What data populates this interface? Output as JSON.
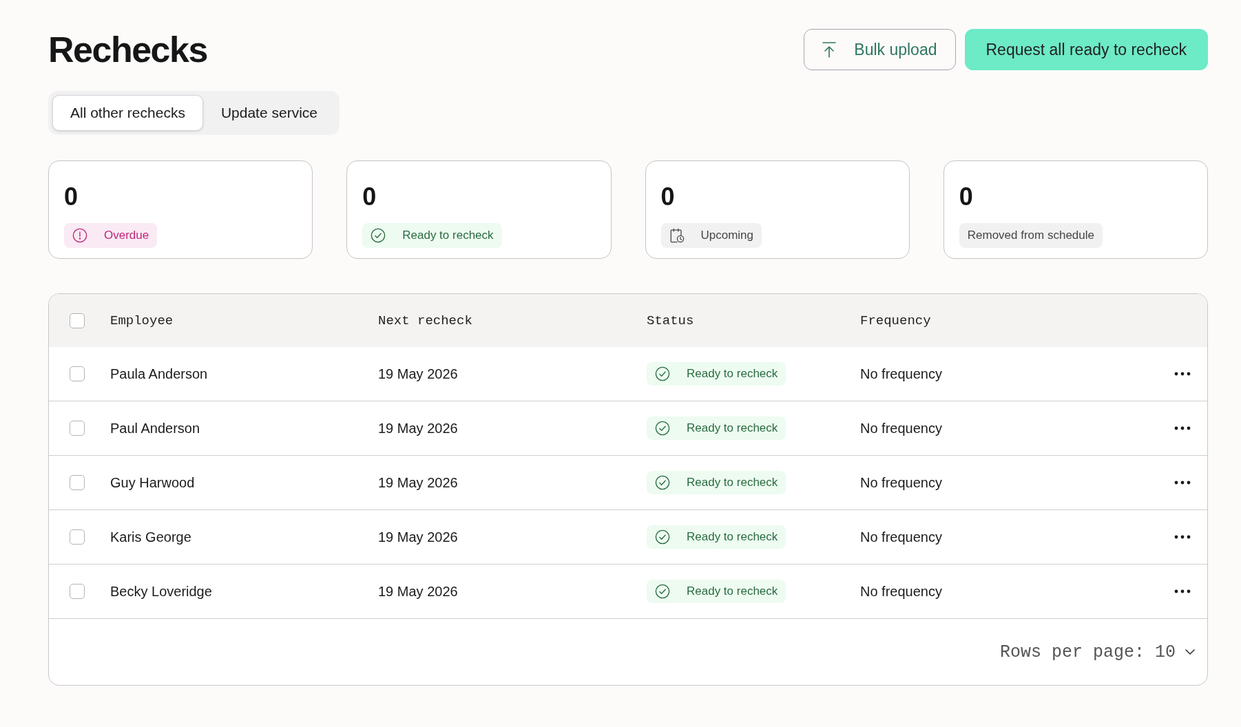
{
  "page": {
    "title": "Rechecks"
  },
  "actions": [
    {
      "kind": "secondary",
      "label": "Bulk upload"
    },
    {
      "kind": "primary",
      "label": "Request all ready to recheck"
    }
  ],
  "tabs": [
    {
      "label": "All other rechecks",
      "selected": true
    },
    {
      "label": "Update service",
      "selected": false
    }
  ],
  "summary_cards": [
    {
      "count": "0",
      "status": {
        "kind": "overdue",
        "label": "Overdue"
      }
    },
    {
      "count": "0",
      "status": {
        "kind": "ready",
        "label": "Ready to recheck"
      }
    },
    {
      "count": "0",
      "status": {
        "kind": "upcoming",
        "label": "Upcoming"
      }
    },
    {
      "count": "0",
      "status": {
        "kind": "removed",
        "label": "Removed from schedule"
      }
    }
  ],
  "table": {
    "header_checkbox": {
      "checked": false
    },
    "columns": [
      "Employee",
      "Next recheck",
      "Status",
      "Frequency"
    ],
    "rows": [
      {
        "checked": false,
        "employee": "Paula Anderson",
        "next_recheck": "19 May 2026",
        "status": {
          "kind": "ready",
          "label": "Ready to recheck"
        },
        "frequency": "No frequency"
      },
      {
        "checked": false,
        "employee": "Paul Anderson",
        "next_recheck": "19 May 2026",
        "status": {
          "kind": "ready",
          "label": "Ready to recheck"
        },
        "frequency": "No frequency"
      },
      {
        "checked": false,
        "employee": "Guy Harwood",
        "next_recheck": "19 May 2026",
        "status": {
          "kind": "ready",
          "label": "Ready to recheck"
        },
        "frequency": "No frequency"
      },
      {
        "checked": false,
        "employee": "Karis George",
        "next_recheck": "19 May 2026",
        "status": {
          "kind": "ready",
          "label": "Ready to recheck"
        },
        "frequency": "No frequency"
      },
      {
        "checked": false,
        "employee": "Becky Loveridge",
        "next_recheck": "19 May 2026",
        "status": {
          "kind": "ready",
          "label": "Ready to recheck"
        },
        "frequency": "No frequency"
      }
    ],
    "pagination": {
      "rows_per_page_label": "Rows per page:",
      "rows_per_page": "10"
    }
  }
}
